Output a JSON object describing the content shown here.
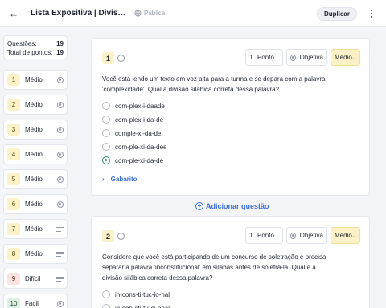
{
  "header": {
    "title": "Lista Expositiva | Divisão Silábica",
    "visibility": "Pública",
    "duplicate_label": "Duplicar"
  },
  "summary": {
    "questions_label": "Questões:",
    "questions_value": "19",
    "points_label": "Total de pontos:",
    "points_value": "19"
  },
  "sidebar": {
    "items": [
      {
        "num": "1",
        "difficulty": "Médio",
        "type": "radio"
      },
      {
        "num": "2",
        "difficulty": "Médio",
        "type": "radio"
      },
      {
        "num": "3",
        "difficulty": "Médio",
        "type": "radio"
      },
      {
        "num": "4",
        "difficulty": "Médio",
        "type": "radio"
      },
      {
        "num": "5",
        "difficulty": "Médio",
        "type": "radio"
      },
      {
        "num": "6",
        "difficulty": "Médio",
        "type": "radio"
      },
      {
        "num": "7",
        "difficulty": "Médio",
        "type": "lines"
      },
      {
        "num": "8",
        "difficulty": "Médio",
        "type": "lines"
      },
      {
        "num": "9",
        "difficulty": "Difícil",
        "type": "lines"
      },
      {
        "num": "10",
        "difficulty": "Fácil",
        "type": "radio"
      }
    ]
  },
  "q1": {
    "num": "1",
    "points_value": "1",
    "points_unit": "Ponto",
    "type": "Objetiva",
    "difficulty": "Médio",
    "text": "Você está lendo um texto em voz alta para a turma e se depara com a palavra 'complexidade'. Qual a divisão silábica correta dessa palavra?",
    "options": [
      "com-plex-i-daade",
      "com-plex-i-da-de",
      "comple-xi-da-de",
      "com-ple-xi-da-dee",
      "com-ple-xi-da-de"
    ],
    "selected": 4,
    "answer_label": "Gabarito"
  },
  "add_question_label": "Adicionar questão",
  "q2": {
    "num": "2",
    "points_value": "1",
    "points_unit": "Ponto",
    "type": "Objetiva",
    "difficulty": "Médio",
    "text": "Considere que você está participando de um concurso de soletração e precisa separar a palavra 'inconstitucional' em sílabas antes de soletrá-la. Qual é a divisão silábica correta dessa palavra?",
    "options": [
      "in-cons-ti-tuc-io-nal",
      "in-con-sti-tu-ci-onal"
    ]
  },
  "colors": {
    "accent": "#3b6fd9",
    "medium": "#fdf1c7",
    "hard": "#fde4e0",
    "easy": "#dff2e6",
    "selected": "#2e9e6e"
  }
}
